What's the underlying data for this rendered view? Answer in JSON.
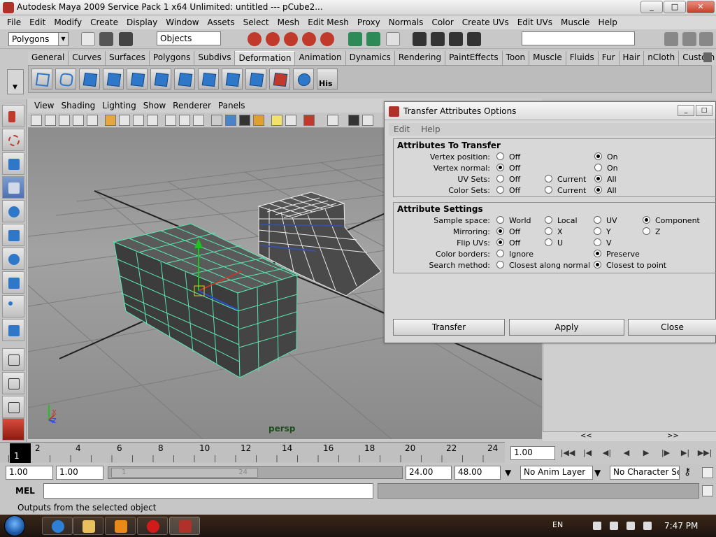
{
  "window": {
    "title": "Autodesk Maya 2009 Service Pack 1 x64 Unlimited: untitled   ---   pCube2...",
    "min": "_",
    "max": "□",
    "close": "✕"
  },
  "menubar": [
    "File",
    "Edit",
    "Modify",
    "Create",
    "Display",
    "Window",
    "Assets",
    "Select",
    "Mesh",
    "Edit Mesh",
    "Proxy",
    "Normals",
    "Color",
    "Create UVs",
    "Edit UVs",
    "Muscle",
    "Help"
  ],
  "statusline": {
    "menu_set": "Polygons",
    "selection_mode": "Objects"
  },
  "shelf": {
    "tabs": [
      "General",
      "Curves",
      "Surfaces",
      "Polygons",
      "Subdivs",
      "Deformation",
      "Animation",
      "Dynamics",
      "Rendering",
      "PaintEffects",
      "Toon",
      "Muscle",
      "Fluids",
      "Fur",
      "Hair",
      "nCloth",
      "Custom"
    ],
    "active_tab": "Deformation",
    "last_icon_label": "His"
  },
  "viewport": {
    "menu": [
      "View",
      "Shading",
      "Lighting",
      "Show",
      "Renderer",
      "Panels"
    ],
    "camera_label": "persp",
    "axis_x": "X",
    "axis_z": "Z"
  },
  "dialog": {
    "title": "Transfer Attributes Options",
    "menu": [
      "Edit",
      "Help"
    ],
    "section1": {
      "title": "Attributes To Transfer",
      "rows": [
        {
          "label": "Vertex position:",
          "options": [
            "Off",
            "On"
          ],
          "selected": "On"
        },
        {
          "label": "Vertex normal:",
          "options": [
            "Off",
            "On"
          ],
          "selected": "Off"
        },
        {
          "label": "UV Sets:",
          "options": [
            "Off",
            "Current",
            "All"
          ],
          "selected": "All"
        },
        {
          "label": "Color Sets:",
          "options": [
            "Off",
            "Current",
            "All"
          ],
          "selected": "All"
        }
      ]
    },
    "section2": {
      "title": "Attribute Settings",
      "rows": [
        {
          "label": "Sample space:",
          "options": [
            "World",
            "Local",
            "UV",
            "Component"
          ],
          "selected": "Component"
        },
        {
          "label": "Mirroring:",
          "options": [
            "Off",
            "X",
            "Y",
            "Z"
          ],
          "selected": "Off"
        },
        {
          "label": "Flip UVs:",
          "options": [
            "Off",
            "U",
            "V"
          ],
          "selected": "Off"
        },
        {
          "label": "Color borders:",
          "options": [
            "Ignore",
            "Preserve"
          ],
          "selected": "Preserve"
        },
        {
          "label": "Search method:",
          "options": [
            "Closest along normal",
            "Closest to point"
          ],
          "selected": "Closest to point"
        }
      ]
    },
    "buttons": {
      "transfer": "Transfer",
      "apply": "Apply",
      "close": "Close"
    }
  },
  "side_nav": {
    "left": "<<",
    "right": ">>"
  },
  "timeslider": {
    "current_frame": "1",
    "tick_labels": [
      "2",
      "4",
      "6",
      "8",
      "10",
      "12",
      "14",
      "16",
      "18",
      "20",
      "22",
      "24"
    ],
    "current_time": "1.00",
    "playback": [
      "|◀◀",
      "|◀",
      "◀|",
      "◀",
      "▶",
      "|▶",
      "▶|",
      "▶▶|"
    ]
  },
  "range": {
    "start_time": "1.00",
    "playback_start": "1.00",
    "slider_start": "1",
    "slider_end": "24",
    "playback_end": "24.00",
    "end_time": "48.00",
    "anim_layer": "No Anim Layer",
    "character_set": "No Character Set"
  },
  "commandline": {
    "label": "MEL"
  },
  "helpline": "Outputs from the selected object",
  "taskbar": {
    "language": "EN",
    "clock": "7:47 PM"
  }
}
